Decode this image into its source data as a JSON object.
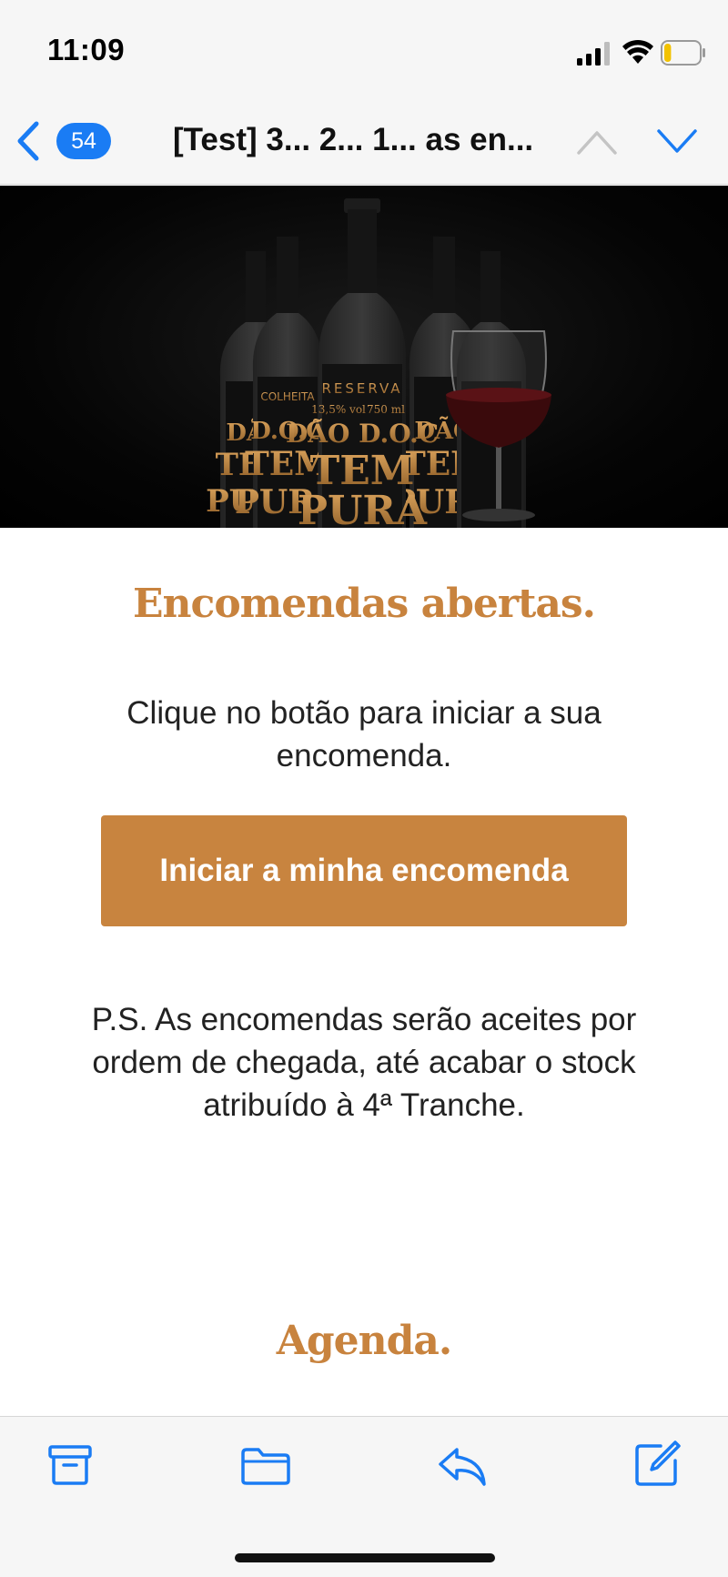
{
  "status_bar": {
    "time": "11:09",
    "battery_level": 0.2
  },
  "nav": {
    "unread_count": "54",
    "subject": "[Test] 3... 2... 1... as en..."
  },
  "email": {
    "headline": "Encomendas abertas.",
    "intro": "Clique no botão para iniciar a sua encomenda.",
    "cta_label": "Iniciar a minha encomenda",
    "ps_text": "P.S. As encomendas serão aceites por ordem de chegada, até acabar o stock atribuído à 4ª Tranche.",
    "agenda_title": "Agenda."
  },
  "hero": {
    "label_texts": [
      "RESERVA",
      "COLHEITA",
      "DÃO D.O.C",
      "TEMPURA",
      "13,5% vol",
      "750 ml"
    ]
  },
  "icons": [
    "back-chevron-icon",
    "archive-icon",
    "folder-icon",
    "reply-icon",
    "compose-icon"
  ],
  "colors": {
    "accent": "#c8843f",
    "ios_blue": "#1a7cf4",
    "toolbar_bg": "#f6f6f6"
  }
}
